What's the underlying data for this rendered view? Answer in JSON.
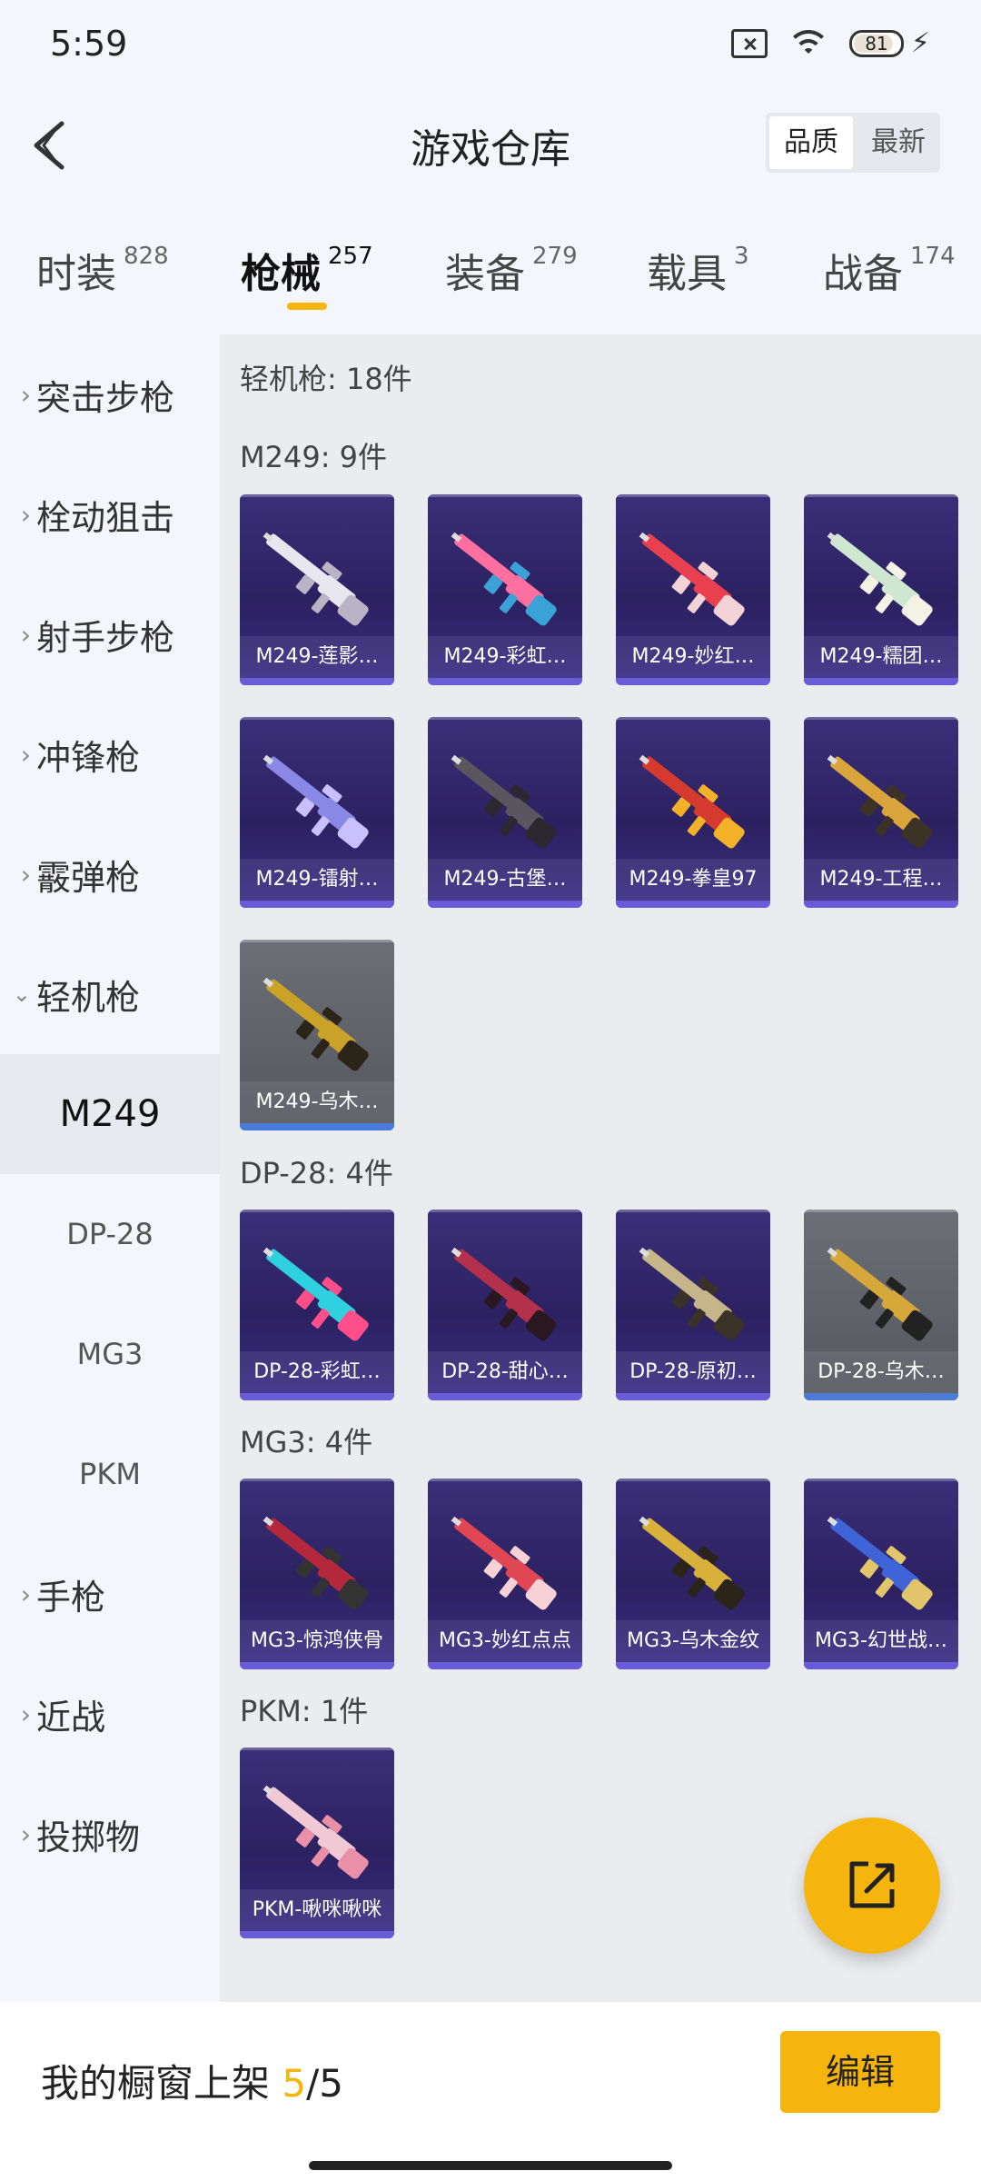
{
  "status": {
    "time": "5:59",
    "battery": "81"
  },
  "header": {
    "title": "游戏仓库",
    "sort": [
      "品质",
      "最新"
    ]
  },
  "tabs": [
    {
      "label": "时装",
      "count": "828"
    },
    {
      "label": "枪械",
      "count": "257"
    },
    {
      "label": "装备",
      "count": "279"
    },
    {
      "label": "载具",
      "count": "3"
    },
    {
      "label": "战备",
      "count": "174"
    }
  ],
  "sidebar": {
    "categories": [
      "突击步枪",
      "栓动狙击",
      "射手步枪",
      "冲锋枪",
      "霰弹枪",
      "轻机枪"
    ],
    "sub": [
      "M249",
      "DP-28",
      "MG3",
      "PKM"
    ],
    "more": [
      "手枪",
      "近战",
      "投掷物"
    ]
  },
  "content": {
    "total": "轻机枪: 18件",
    "groups": [
      {
        "title": "M249: 9件",
        "items": [
          "M249-莲影…",
          "M249-彩虹…",
          "M249-妙红…",
          "M249-糯团…",
          "M249-镭射…",
          "M249-古堡…",
          "M249-拳皇97",
          "M249-工程…",
          "M249-乌木…"
        ]
      },
      {
        "title": "DP-28: 4件",
        "items": [
          "DP-28-彩虹…",
          "DP-28-甜心…",
          "DP-28-原初…",
          "DP-28-乌木…"
        ]
      },
      {
        "title": "MG3: 4件",
        "items": [
          "MG3-惊鸿侠骨",
          "MG3-妙红点点",
          "MG3-乌木金纹",
          "MG3-幻世战…"
        ]
      },
      {
        "title": "PKM: 1件",
        "items": [
          "PKM-啾咪啾咪"
        ]
      }
    ]
  },
  "bottom": {
    "label": "我的橱窗上架",
    "current": "5",
    "total": "/5",
    "edit": "编辑"
  },
  "colors": {
    "accent": "#f5b50d",
    "card_purple": "#3b2f7a",
    "card_gray": "#6d6f76"
  },
  "icons": [
    "back-arrow-icon",
    "chevron-right-icon",
    "chevron-down-icon",
    "share-external-icon",
    "wifi-icon",
    "battery-icon",
    "sim-off-icon",
    "charging-bolt-icon"
  ]
}
